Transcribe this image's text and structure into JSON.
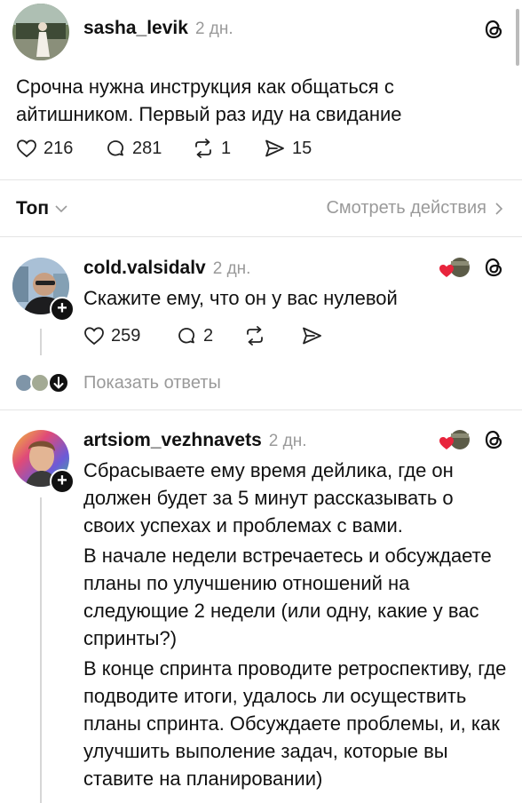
{
  "post": {
    "username": "sasha_levik",
    "time": "2 дн.",
    "text": "Срочна нужна инструкция как общаться с айтишником. Первый раз иду на свидание",
    "likes": "216",
    "comments": "281",
    "reposts": "1",
    "shares": "15"
  },
  "filter": {
    "sort_label": "Топ",
    "activity_link": "Смотреть действия"
  },
  "replies": [
    {
      "username": "cold.valsidalv",
      "time": "2 дн.",
      "text": "Скажите ему, что он у вас нулевой",
      "likes": "259",
      "comments": "2",
      "show_replies": "Показать ответы"
    },
    {
      "username": "artsiom_vezhnavets",
      "time": "2 дн.",
      "paragraphs": [
        "Сбрасываете ему время дейлика, где он должен будет за 5 минут рассказывать о своих успехах и проблемах с вами.",
        "В начале недели встречаетесь и обсуждаете планы по улучшению отношений на следующие 2 недели (или одну, какие у вас спринты?)",
        "В конце спринта проводите ретроспективу, где подводите итоги, удалось ли осуществить планы спринта. Обсуждаете проблемы, и, как улучшить выполение задач, которые вы ставите на планировании)"
      ]
    }
  ],
  "colors": {
    "heart_red": "#e8243c",
    "muted": "#9a9a9a",
    "divider": "#e4e4e4"
  },
  "icons": [
    "threads-logo-icon",
    "heart-icon",
    "comment-icon",
    "repost-icon",
    "share-icon",
    "chevron-down-icon",
    "chevron-right-icon",
    "plus-icon",
    "arrow-down-icon"
  ]
}
